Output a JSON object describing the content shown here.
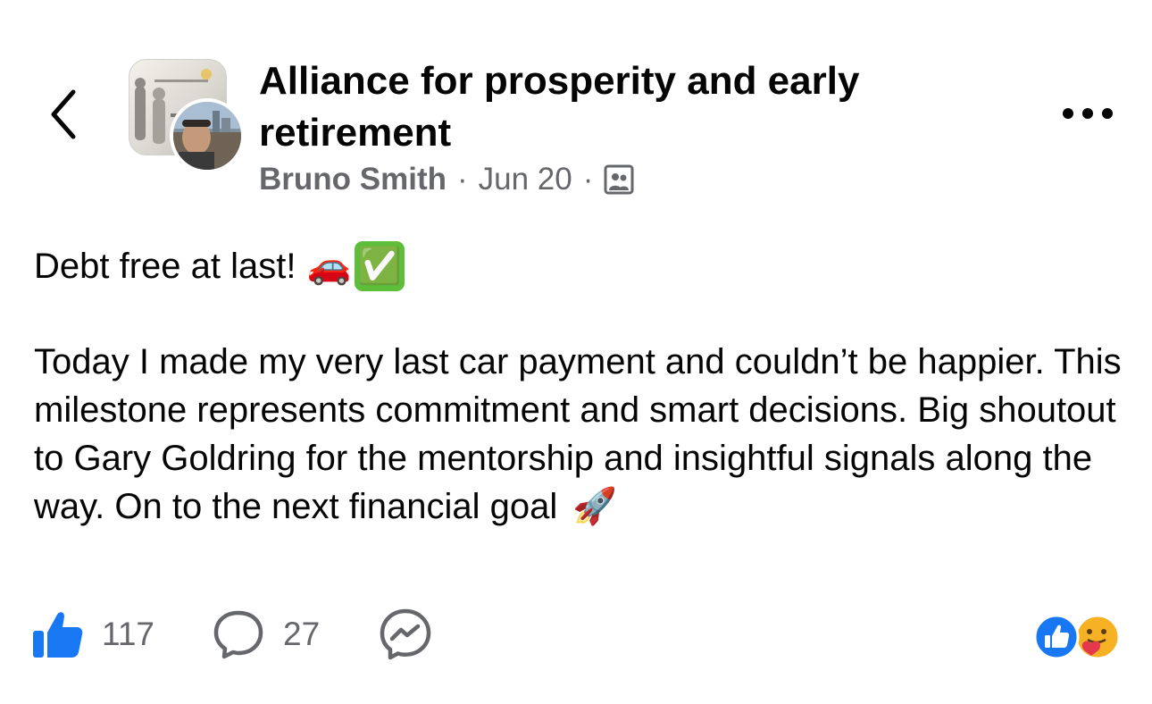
{
  "header": {
    "group_name": "Alliance for prosperity and early retirement",
    "author": "Bruno Smith",
    "date": "Jun 20",
    "separator": "·",
    "audience_icon": "group-audience-icon"
  },
  "post": {
    "title": "Debt free at last!",
    "title_emojis": [
      "🚗",
      "✅"
    ],
    "body": "Today I made my very last car payment and couldn’t be happier. This milestone represents commitment and smart decisions. Big shoutout to Gary Goldring for the mentorship and insightful signals along the way. On to the next financial goal",
    "body_emoji": "🚀"
  },
  "actions": {
    "likes": "117",
    "comments": "27"
  },
  "colors": {
    "like_blue": "#1877f2",
    "secondary_text": "#65676b",
    "check_green": "#5dbe39"
  },
  "icons": [
    "back-chevron-icon",
    "more-dots-icon",
    "like-thumb-icon",
    "comment-bubble-icon",
    "messenger-icon",
    "like-reaction-icon",
    "care-reaction-icon"
  ]
}
